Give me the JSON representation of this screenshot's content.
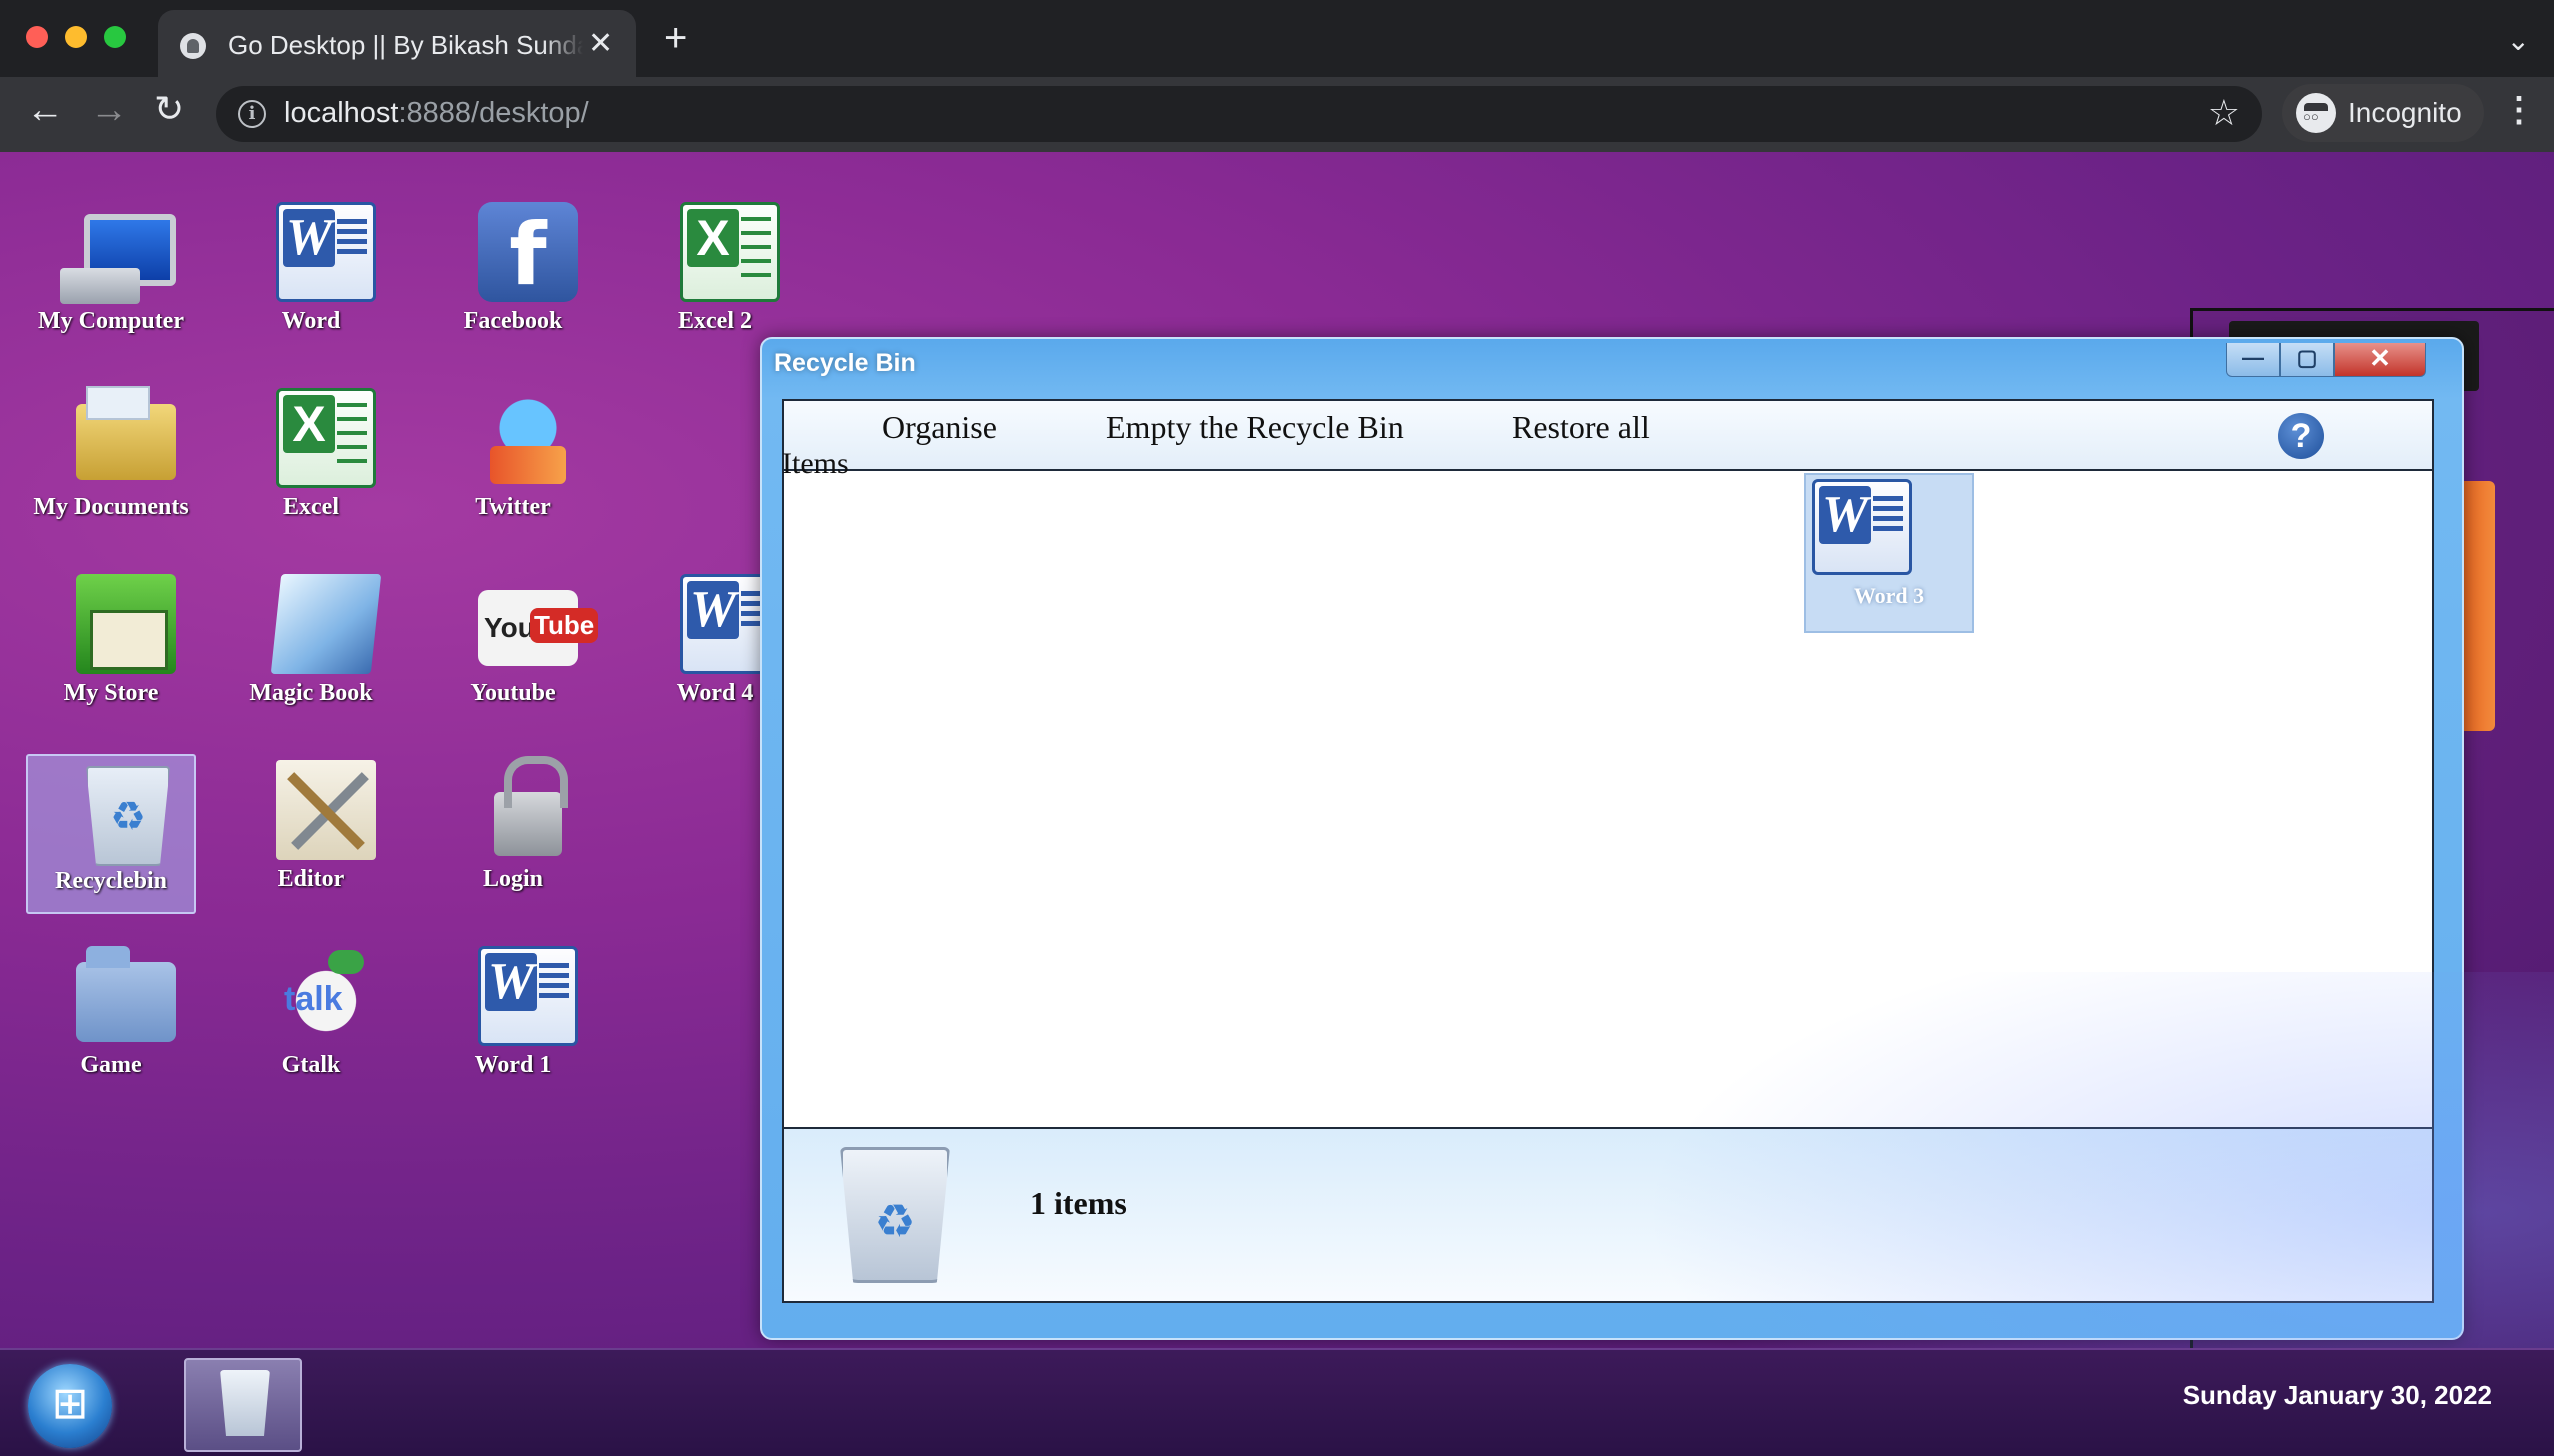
{
  "browser": {
    "tab_title": "Go Desktop || By Bikash Sundaray",
    "url_host": "localhost",
    "url_rest": ":8888/desktop/",
    "incognito_label": "Incognito"
  },
  "desktop": {
    "icons": [
      {
        "label": "My Computer",
        "icon": "computer-icon"
      },
      {
        "label": "Word",
        "icon": "word-icon"
      },
      {
        "label": "Facebook",
        "icon": "facebook-icon"
      },
      {
        "label": "Excel 2",
        "icon": "excel-icon"
      },
      {
        "label": "My Documents",
        "icon": "documents-folder-icon"
      },
      {
        "label": "Excel",
        "icon": "excel-icon"
      },
      {
        "label": "Twitter",
        "icon": "twitter-icon"
      },
      {
        "label": "My Store",
        "icon": "store-icon"
      },
      {
        "label": "Magic Book",
        "icon": "notepad-icon"
      },
      {
        "label": "Youtube",
        "icon": "youtube-icon"
      },
      {
        "label": "Word 4",
        "icon": "word-icon"
      },
      {
        "label": "Recyclebin",
        "icon": "recycle-bin-icon"
      },
      {
        "label": "Editor",
        "icon": "tools-icon"
      },
      {
        "label": "Login",
        "icon": "lock-icon"
      },
      {
        "label": "Game",
        "icon": "game-folder-icon"
      },
      {
        "label": "Gtalk",
        "icon": "gtalk-icon"
      },
      {
        "label": "Word 1",
        "icon": "word-icon"
      }
    ]
  },
  "window": {
    "title": "Recycle Bin",
    "min_symbol": "—",
    "max_symbol": "▢",
    "close_symbol": "✕",
    "commands": {
      "organise": "Organise",
      "empty": "Empty the Recycle Bin",
      "restore": "Restore all"
    },
    "help_symbol": "?",
    "items_label": "Items",
    "files": [
      {
        "label": "Word 3",
        "icon": "word-icon"
      }
    ],
    "status_count": "1 items"
  },
  "taskbar": {
    "clock": "Sunday January 30, 2022"
  },
  "colors": {
    "window_frame": "#63aeee",
    "desktop_accent": "#8a2a94",
    "close_button": "#c3342a"
  }
}
